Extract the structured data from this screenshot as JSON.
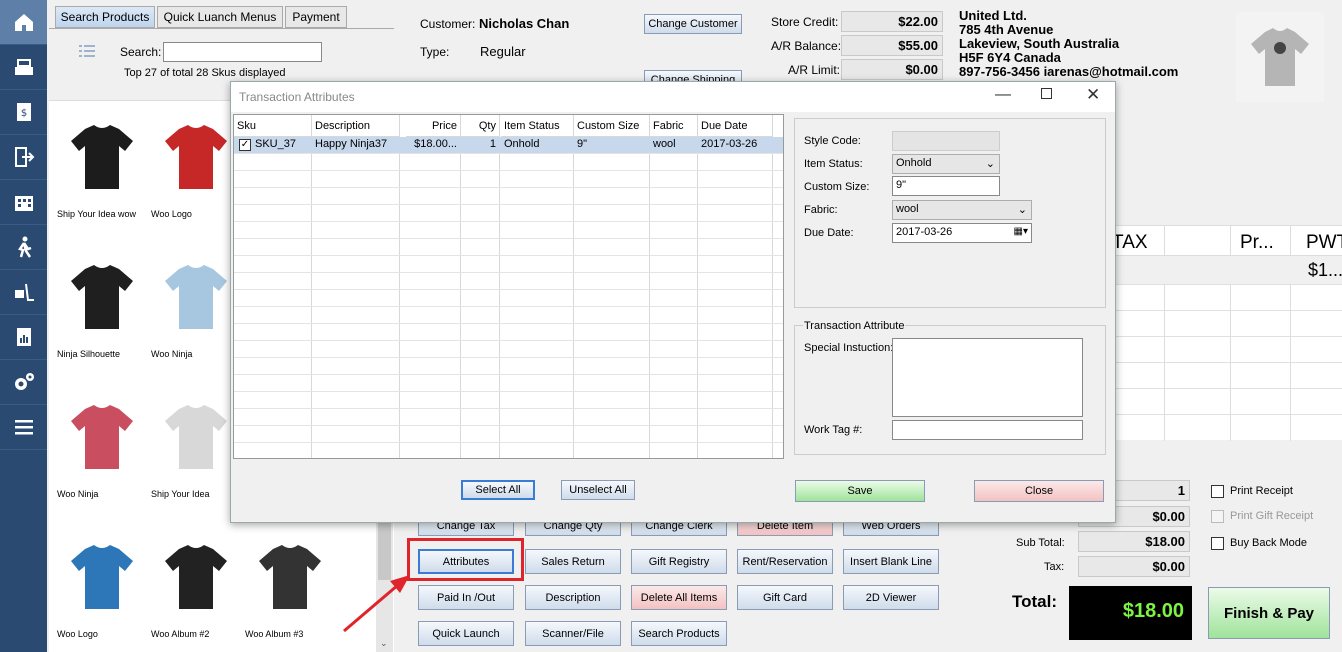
{
  "nav": {
    "items": [
      "home-icon",
      "register-icon",
      "receipt-icon",
      "exit-icon",
      "building-icon",
      "walk-icon",
      "dolly-icon",
      "report-icon",
      "settings-icon",
      "menu-icon"
    ]
  },
  "left": {
    "tabs": [
      "Search Products",
      "Quick Luanch Menus",
      "Payment"
    ],
    "search_label": "Search:",
    "search_value": "",
    "count_text": "Top 27 of total 28 Skus displayed",
    "products": [
      {
        "name": "Ship Your Idea wow"
      },
      {
        "name": "Woo Logo"
      },
      {
        "name": "Ninja Silhouette"
      },
      {
        "name": "Woo Ninja"
      },
      {
        "name": "Woo Ninja"
      },
      {
        "name": "Ship Your Idea"
      },
      {
        "name": "Woo Logo"
      },
      {
        "name": "Woo Album #2"
      },
      {
        "name": "Woo Album #3"
      }
    ]
  },
  "customer": {
    "customer_label": "Customer:",
    "customer_name": "Nicholas Chan",
    "type_label": "Type:",
    "type_value": "Regular",
    "change_customer": "Change Customer",
    "change_shipping": "Change Shipping",
    "store_credit_label": "Store Credit:",
    "store_credit": "$22.00",
    "ar_balance_label": "A/R Balance:",
    "ar_balance": "$55.00",
    "ar_limit_label": "A/R Limit:",
    "ar_limit": "$0.00",
    "address": [
      "United Ltd.",
      "785 4th Avenue",
      "Lakeview, South Australia",
      "H5F 6Y4 Canada",
      "897-756-3456 iarenas@hotmail.com"
    ]
  },
  "cart": {
    "headers": [
      "TAX",
      "Pr...",
      "PWT"
    ],
    "row_value": "$1..."
  },
  "totals": {
    "qty": "1",
    "discount": "$0.00",
    "subtotal_label": "Sub Total:",
    "subtotal": "$18.00",
    "tax_label": "Tax:",
    "tax": "$0.00",
    "total_label": "Total:",
    "total": "$18.00",
    "finish_pay": "Finish & Pay",
    "print_receipt": "Print Receipt",
    "print_gift_receipt": "Print Gift Receipt",
    "buy_back_mode": "Buy Back Mode"
  },
  "actions": [
    [
      "Change Tax",
      "Change Qty",
      "Change Clerk",
      "Delete Item",
      "Web Orders"
    ],
    [
      "Attributes",
      "Sales Return",
      "Gift Registry",
      "Rent/Reservation",
      "Insert Blank Line"
    ],
    [
      "Paid In /Out",
      "Description",
      "Delete All Items",
      "Gift Card",
      "2D Viewer"
    ],
    [
      "Quick Launch",
      "Scanner/File",
      "Search Products"
    ]
  ],
  "dialog": {
    "title": "Transaction Attributes",
    "columns": [
      "Sku",
      "Description",
      "Price",
      "Qty",
      "Item Status",
      "Custom Size",
      "Fabric",
      "Due Date"
    ],
    "rows": [
      {
        "sku": "SKU_37",
        "description": "Happy Ninja37",
        "price": "$18.00...",
        "qty": "1",
        "status": "Onhold",
        "size": "9\"",
        "fabric": "wool",
        "due": "2017-03-26",
        "checked": true
      }
    ],
    "style_code_label": "Style Code:",
    "style_code": "",
    "item_status_label": "Item Status:",
    "item_status": "Onhold",
    "custom_size_label": "Custom Size:",
    "custom_size": "9\"",
    "fabric_label": "Fabric:",
    "fabric": "wool",
    "due_date_label": "Due Date:",
    "due_date": "2017-03-26",
    "trans_group": "Transaction Attribute",
    "special_label": "Special Instuction:",
    "special_value": "",
    "worktag_label": "Work Tag #:",
    "worktag_value": "",
    "select_all": "Select All",
    "unselect_all": "Unselect All",
    "save": "Save",
    "close": "Close"
  }
}
